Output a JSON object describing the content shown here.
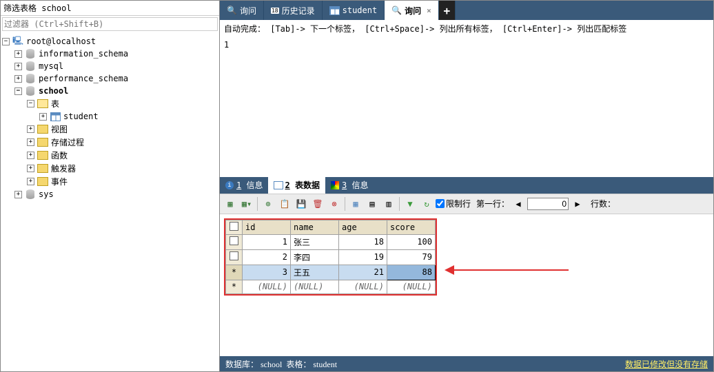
{
  "sidebar": {
    "filter_title": "筛选表格 school",
    "filter_placeholder": "过滤器 (Ctrl+Shift+B)",
    "root": "root@localhost",
    "databases": [
      "information_schema",
      "mysql",
      "performance_schema",
      "school",
      "sys"
    ],
    "school_expanded": true,
    "school_folders": {
      "tables": "表",
      "views": "视图",
      "procedures": "存储过程",
      "functions": "函数",
      "triggers": "触发器",
      "events": "事件"
    },
    "table_name": "student"
  },
  "tabs": [
    {
      "label": "询问",
      "icon": "🔍"
    },
    {
      "label": "历史记录",
      "icon": "📅",
      "badge": "18"
    },
    {
      "label": "student",
      "icon": "▦"
    },
    {
      "label": "询问",
      "icon": "🔍",
      "active": true,
      "closable": true
    }
  ],
  "editor": {
    "hint": "自动完成： [Tab]-> 下一个标签， [Ctrl+Space]-> 列出所有标签， [Ctrl+Enter]-> 列出匹配标签",
    "line1": "1"
  },
  "bottom_tabs": [
    {
      "key": "1",
      "label": "信息"
    },
    {
      "key": "2",
      "label": "表数据",
      "active": true
    },
    {
      "key": "3",
      "label": "信息"
    }
  ],
  "toolbar": {
    "limit_label": "限制行",
    "first_row_label": "第一行：",
    "first_row_value": "0",
    "rows_label": "行数："
  },
  "grid": {
    "columns": [
      "id",
      "name",
      "age",
      "score"
    ],
    "rows": [
      {
        "id": 1,
        "name": "张三",
        "age": 18,
        "score": 100
      },
      {
        "id": 2,
        "name": "李四",
        "age": 19,
        "score": 79
      },
      {
        "id": 3,
        "name": "王五",
        "age": 21,
        "score": 88,
        "selected": true
      }
    ],
    "null_placeholder": "(NULL)"
  },
  "statusbar": {
    "db_label": "数据库：",
    "db_value": "school",
    "table_label": "表格：",
    "table_value": "student",
    "right": "数据已修改但没有存储"
  }
}
